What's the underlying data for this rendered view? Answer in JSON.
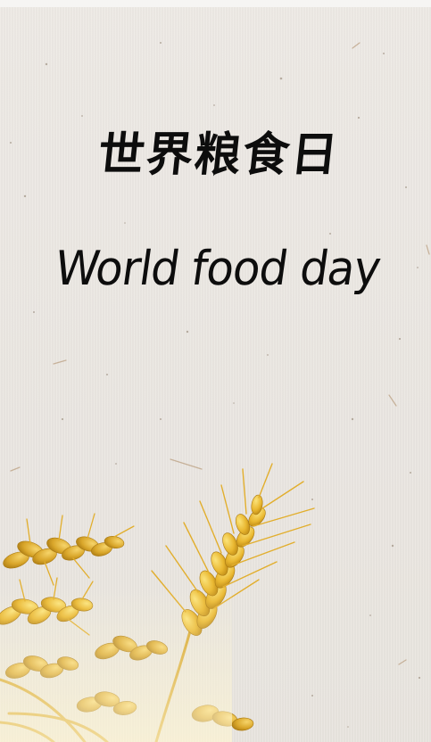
{
  "poster": {
    "title_cn": "世界粮食日",
    "title_en": "World food day"
  },
  "colors": {
    "paper": "#ece8e3",
    "ink": "#0d0d0d",
    "wheat_light": "#f7d654",
    "wheat_mid": "#e7b52a",
    "wheat_dark": "#b98512"
  },
  "decorations": {
    "illustration": "wheat-sheaf",
    "texture": "rice-paper"
  }
}
